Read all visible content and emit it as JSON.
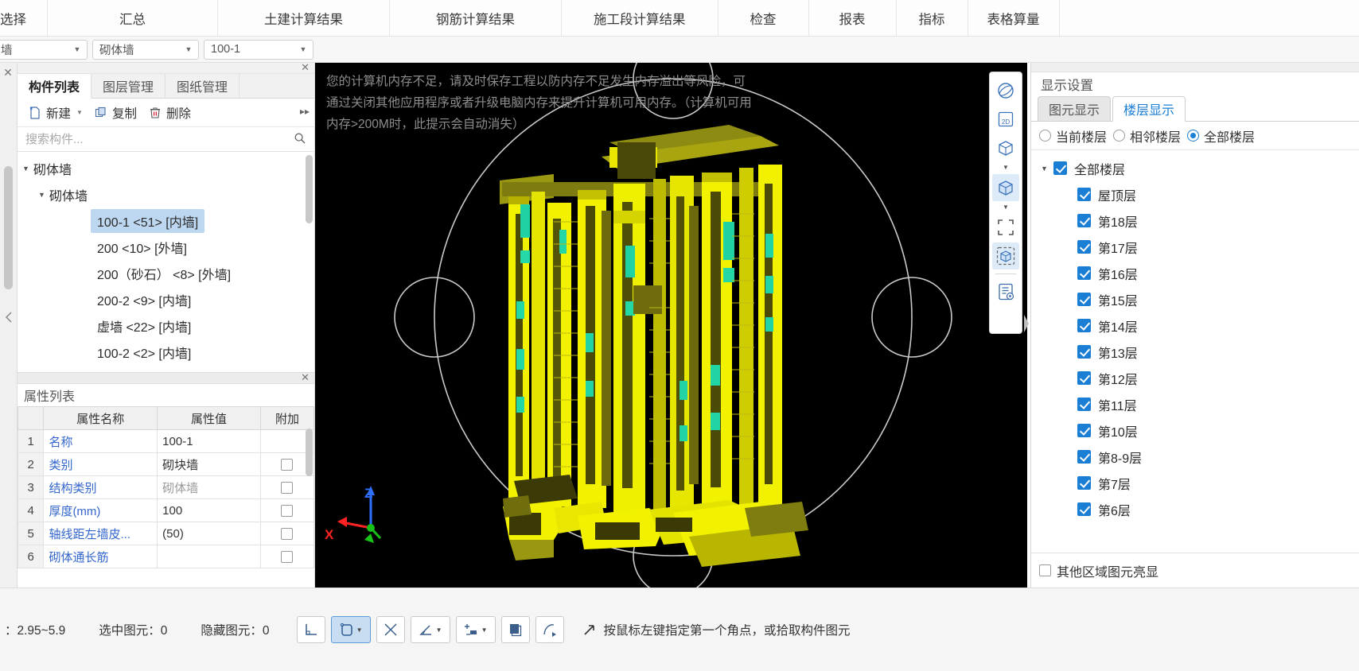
{
  "topbar": {
    "tabs": [
      {
        "label": "选择",
        "clipped": true
      },
      {
        "label": "汇总"
      },
      {
        "label": "土建计算结果"
      },
      {
        "label": "钢筋计算结果"
      },
      {
        "label": "施工段计算结果"
      },
      {
        "label": "检查"
      },
      {
        "label": "报表"
      },
      {
        "label": "指标"
      },
      {
        "label": "表格算量"
      }
    ]
  },
  "combobar": {
    "combo0": {
      "value": "墙",
      "name": "category-select"
    },
    "combo1": {
      "value": "砌体墙",
      "name": "component-type-select"
    },
    "combo2": {
      "value": "100-1",
      "name": "component-name-select"
    }
  },
  "left_panel": {
    "tabs": [
      {
        "label": "构件列表",
        "active": true
      },
      {
        "label": "图层管理",
        "active": false
      },
      {
        "label": "图纸管理",
        "active": false
      }
    ],
    "toolbar": {
      "new_label": "新建",
      "copy_label": "复制",
      "delete_label": "删除"
    },
    "search_placeholder": "搜索构件...",
    "search_value": "",
    "tree": [
      {
        "label": "砌体墙",
        "level": 0,
        "expanded": true,
        "leaf": false,
        "selected": false
      },
      {
        "label": "砌体墙",
        "level": 1,
        "expanded": true,
        "leaf": false,
        "selected": false
      },
      {
        "label": "100-1 <51> [内墙]",
        "level": 2,
        "leaf": true,
        "selected": true
      },
      {
        "label": "200 <10> [外墙]",
        "level": 2,
        "leaf": true,
        "selected": false
      },
      {
        "label": "200（砂石） <8> [外墙]",
        "level": 2,
        "leaf": true,
        "selected": false
      },
      {
        "label": "200-2 <9> [内墙]",
        "level": 2,
        "leaf": true,
        "selected": false
      },
      {
        "label": "虚墙 <22> [内墙]",
        "level": 2,
        "leaf": true,
        "selected": false
      },
      {
        "label": "100-2 <2> [内墙]",
        "level": 2,
        "leaf": true,
        "selected": false
      }
    ],
    "properties": {
      "title": "属性列表",
      "columns": [
        "",
        "属性名称",
        "属性值",
        "附加"
      ],
      "rows": [
        {
          "idx": "1",
          "name": "名称",
          "value": "100-1",
          "muted": false,
          "attach": false
        },
        {
          "idx": "2",
          "name": "类别",
          "value": "砌块墙",
          "muted": false,
          "attach": true
        },
        {
          "idx": "3",
          "name": "结构类别",
          "value": "砌体墙",
          "muted": true,
          "attach": true
        },
        {
          "idx": "4",
          "name": "厚度(mm)",
          "value": "100",
          "muted": false,
          "attach": true
        },
        {
          "idx": "5",
          "name": "轴线距左墙皮...",
          "value": "(50)",
          "muted": false,
          "attach": true
        },
        {
          "idx": "6",
          "name": "砌体通长筋",
          "value": "",
          "muted": false,
          "attach": true
        }
      ]
    }
  },
  "viewport": {
    "warning": "您的计算机内存不足，请及时保存工程以防内存不足发生内存溢出等风险，可通过关闭其他应用程序或者升级电脑内存来提升计算机可用内存。（计算机可用内存>200M时，此提示会自动消失）",
    "axis_z": "Z",
    "axis_x": "X",
    "model_color": "#f2f200"
  },
  "view_rail": {
    "buttons": [
      {
        "name": "orbit-icon",
        "active": false
      },
      {
        "name": "view-2d-icon",
        "label": "2D",
        "active": false
      },
      {
        "name": "view-3d-icon",
        "active": false
      },
      {
        "name": "chevron-down-icon",
        "active": false
      },
      {
        "name": "solid-box-icon",
        "active": true
      },
      {
        "name": "chevron-down-icon-2",
        "active": false
      },
      {
        "name": "crop-region-icon",
        "active": false
      },
      {
        "name": "isolate-element-icon",
        "active": true
      },
      {
        "name": "display-settings-icon",
        "active": false
      }
    ]
  },
  "right_panel": {
    "title": "显示设置",
    "tabs": [
      {
        "label": "图元显示",
        "active": false
      },
      {
        "label": "楼层显示",
        "active": true
      }
    ],
    "radios": [
      {
        "label": "当前楼层",
        "selected": false
      },
      {
        "label": "相邻楼层",
        "selected": false
      },
      {
        "label": "全部楼层",
        "selected": true
      }
    ],
    "floors": [
      {
        "label": "全部楼层",
        "checked": true,
        "root": true
      },
      {
        "label": "屋顶层",
        "checked": true,
        "root": false
      },
      {
        "label": "第18层",
        "checked": true,
        "root": false
      },
      {
        "label": "第17层",
        "checked": true,
        "root": false
      },
      {
        "label": "第16层",
        "checked": true,
        "root": false
      },
      {
        "label": "第15层",
        "checked": true,
        "root": false
      },
      {
        "label": "第14层",
        "checked": true,
        "root": false
      },
      {
        "label": "第13层",
        "checked": true,
        "root": false
      },
      {
        "label": "第12层",
        "checked": true,
        "root": false
      },
      {
        "label": "第11层",
        "checked": true,
        "root": false
      },
      {
        "label": "第10层",
        "checked": true,
        "root": false
      },
      {
        "label": "第8-9层",
        "checked": true,
        "root": false
      },
      {
        "label": "第7层",
        "checked": true,
        "root": false
      },
      {
        "label": "第6层",
        "checked": true,
        "root": false
      }
    ],
    "footer_checkbox_label": "其他区域图元亮显",
    "footer_checked": false
  },
  "statusbar": {
    "elevation": "：2.95~5.9",
    "selected_label": "选中图元：0",
    "hidden_label": "隐藏图元：0",
    "hint": "按鼠标左键指定第一个角点，或拾取构件图元",
    "tools": [
      {
        "name": "ortho-snap-icon",
        "active": false,
        "dropdown": false
      },
      {
        "name": "rect-select-icon",
        "active": true,
        "dropdown": true
      },
      {
        "name": "intersection-snap-icon",
        "active": false,
        "dropdown": false
      },
      {
        "name": "angle-snap-icon",
        "active": false,
        "dropdown": true
      },
      {
        "name": "insert-point-icon",
        "active": false,
        "dropdown": true
      },
      {
        "name": "element-snap-icon",
        "active": false,
        "dropdown": false
      },
      {
        "name": "polyline-icon",
        "active": false,
        "dropdown": false
      }
    ]
  }
}
